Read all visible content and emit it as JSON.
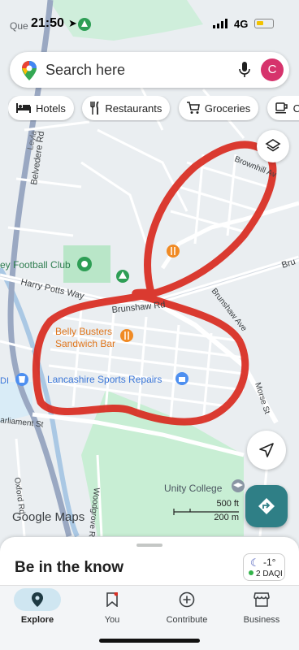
{
  "status_bar": {
    "time": "21:50",
    "network": "4G"
  },
  "search": {
    "placeholder": "Search here",
    "avatar_initial": "C"
  },
  "chips": [
    {
      "label": "Hotels",
      "icon": "bed-icon"
    },
    {
      "label": "Restaurants",
      "icon": "fork-knife-icon"
    },
    {
      "label": "Groceries",
      "icon": "cart-icon"
    },
    {
      "label": "Co",
      "icon": "coffee-icon"
    }
  ],
  "map": {
    "labels": {
      "queens": "Que",
      "belvedere": "Belvedere Rd",
      "leyland": "Leyla",
      "football_club": "ey Football Club",
      "harry_potts": "Harry Potts Way",
      "brunshaw_rd": "Brunshaw Rd",
      "brunshaw_ave": "Brunshaw Ave",
      "brownhill": "Brownhill Av",
      "bru": "Bru",
      "belly_busters_1": "Belly Busters",
      "belly_busters_2": "Sandwich Bar",
      "lancashire": "Lancashire Sports Repairs",
      "di": "DI",
      "parliament": "arliament St",
      "morse": "Morse St",
      "oxford": "Oxford Rd",
      "woodgrove": "Woodgrove Rd",
      "unity": "Unity College"
    },
    "logo": "Google Maps",
    "scale_ft": "500 ft",
    "scale_m": "200 m",
    "colors": {
      "annotation": "#d8261b",
      "park": "#c3ebcf",
      "poi_food": "#f08a24",
      "poi_shop": "#4d8ff0",
      "poi_park": "#2e9e55"
    }
  },
  "sheet": {
    "title": "Be in the know",
    "temperature": "-1°",
    "aqi": "2 DAQI"
  },
  "nav": [
    {
      "label": "Explore",
      "icon": "explore-pin-icon",
      "active": true
    },
    {
      "label": "You",
      "icon": "bookmark-icon",
      "active": false
    },
    {
      "label": "Contribute",
      "icon": "add-circle-icon",
      "active": false
    },
    {
      "label": "Business",
      "icon": "storefront-icon",
      "active": false
    }
  ]
}
